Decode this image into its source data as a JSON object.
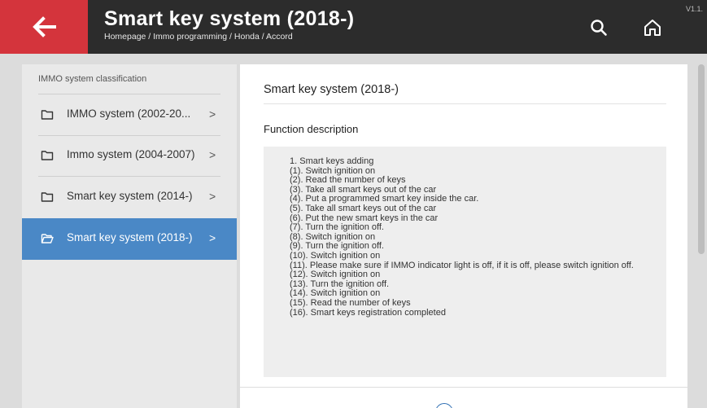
{
  "header": {
    "title": "Smart key system (2018-)",
    "breadcrumb": "Homepage / Immo programming / Honda / Accord",
    "version": "V1.1.",
    "back_icon": "arrow-left-icon",
    "search_icon": "search-icon",
    "home_icon": "home-icon",
    "accent_color": "#d4343c"
  },
  "sidebar": {
    "heading": "IMMO system classification",
    "items": [
      {
        "label": "IMMO system (2002-20...",
        "chevron": ">",
        "active": false
      },
      {
        "label": "Immo system (2004-2007)",
        "chevron": ">",
        "active": false
      },
      {
        "label": "Smart key system (2014-)",
        "chevron": ">",
        "active": false
      },
      {
        "label": "Smart key system (2018-)",
        "chevron": ">",
        "active": true
      }
    ],
    "active_color": "#4a88c6"
  },
  "main": {
    "title": "Smart key system (2018-)",
    "function_title": "Function description",
    "description_lines": [
      "1. Smart keys adding",
      "(1). Switch ignition on",
      "(2). Read the number of keys",
      "(3). Take all smart keys out of the car",
      "(4). Put a programmed smart key inside the car.",
      "(5). Take all smart keys out of the car",
      "(6). Put the new smart keys in the car",
      "(7). Turn the ignition off.",
      "(8). Switch ignition on",
      "(9). Turn the ignition off.",
      "(10). Switch ignition on",
      "(11). Please make sure if IMMO indicator light is off, if it is off, please switch ignition off.",
      "(12). Switch ignition on",
      "(13). Turn the ignition off.",
      "(14). Switch ignition on",
      "(15). Read the number of keys",
      "(16). Smart keys registration completed"
    ]
  }
}
